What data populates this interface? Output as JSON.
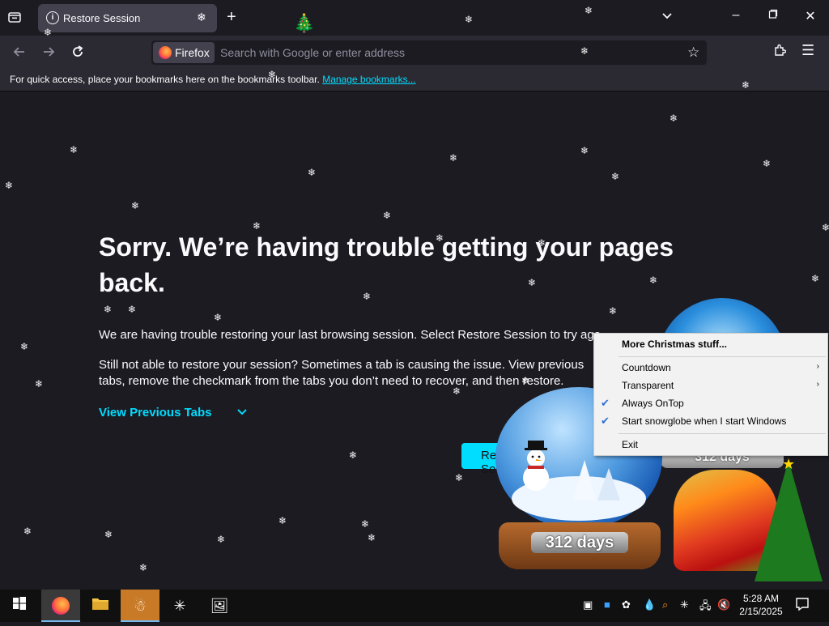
{
  "browser": {
    "tab_title": "Restore Session",
    "identity_label": "Firefox",
    "search_placeholder": "Search with Google or enter address",
    "bookmarks_text": "For quick access, place your bookmarks here on the bookmarks toolbar.",
    "bookmarks_link": "Manage bookmarks..."
  },
  "page": {
    "heading": "Sorry. We’re having trouble getting your pages back.",
    "paragraph1": "We are having trouble restoring your last browsing session. Select Restore Session to try again.",
    "paragraph2": "Still not able to restore your session? Sometimes a tab is causing the issue. View previous tabs, remove the checkmark from the tabs you don’t need to recover, and then restore.",
    "view_previous_tabs": "View Previous Tabs",
    "restore_button": "Restore Session"
  },
  "snowglobe": {
    "days_label_1": "312 days",
    "days_label_2": "312 days"
  },
  "context_menu": {
    "items": [
      {
        "label": "More Christmas stuff..."
      },
      {
        "label": "Countdown"
      },
      {
        "label": "Transparent"
      },
      {
        "label": "Always OnTop"
      },
      {
        "label": "Start snowglobe when I start Windows"
      },
      {
        "label": "Exit"
      }
    ]
  },
  "taskbar": {
    "time": "5:28 AM",
    "date": "2/15/2025"
  },
  "colors": {
    "accent": "#00ddff",
    "tab_bg": "#42414d",
    "toolbar_bg": "#2b2a33",
    "page_bg": "#1c1b22"
  },
  "icons": [
    "tab-list-icon",
    "info-icon",
    "snowflake-icon",
    "plus-icon",
    "chevron-down-icon",
    "minimize-icon",
    "maximize-icon",
    "close-icon",
    "back-icon",
    "forward-icon",
    "reload-icon",
    "firefox-icon",
    "star-icon",
    "extensions-icon",
    "menu-icon",
    "windows-start-icon",
    "file-explorer-icon",
    "notification-icon"
  ]
}
